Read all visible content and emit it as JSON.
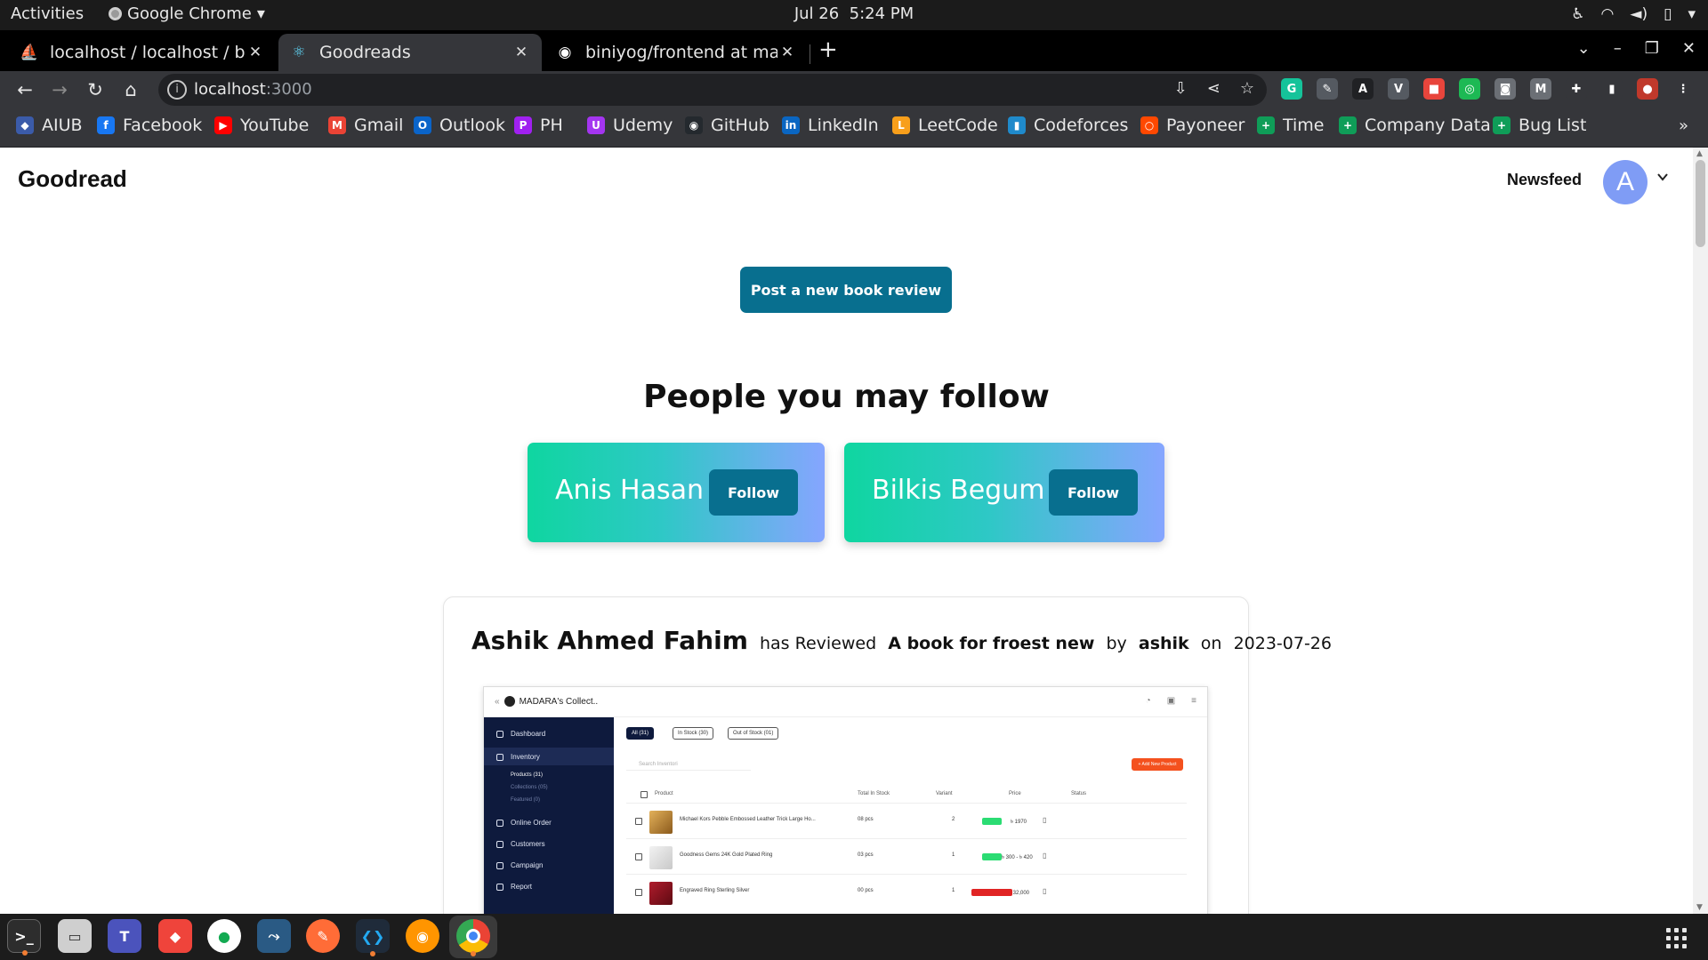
{
  "os": {
    "activities": "Activities",
    "app_name": "Google Chrome",
    "app_menu_arrow": "▾",
    "date": "Jul 26",
    "time": "5:24 PM",
    "tray_icons": [
      "accessibility-icon",
      "wifi-icon",
      "volume-icon",
      "battery-icon"
    ]
  },
  "tabs": [
    {
      "title": "localhost / localhost / bini",
      "favicon": "phpmyadmin-icon",
      "close": "✕"
    },
    {
      "title": "Goodreads",
      "favicon": "react-icon",
      "close": "✕",
      "active": true
    },
    {
      "title": "biniyog/frontend at main",
      "favicon": "github-icon",
      "close": "✕"
    }
  ],
  "new_tab": "+",
  "window_controls": {
    "tab_search": "⌄",
    "minimize": "–",
    "restore": "❐",
    "close": "✕"
  },
  "toolbar": {
    "back": "←",
    "forward": "→",
    "reload": "↻",
    "home": "⌂",
    "url_host": "localhost",
    "url_port": ":3000",
    "info": "i",
    "omni_icons": [
      "install-icon",
      "share-icon",
      "bookmark-star-icon"
    ]
  },
  "extensions": [
    {
      "name": "grammarly-icon",
      "glyph": "G",
      "color": "#15c39a"
    },
    {
      "name": "pen-extension-icon",
      "glyph": "✎",
      "color": "#555a61"
    },
    {
      "name": "font-extension-icon",
      "glyph": "A",
      "color": "#202124"
    },
    {
      "name": "vue-devtools-icon",
      "glyph": "V",
      "color": "#555a61"
    },
    {
      "name": "red-extension-icon",
      "glyph": "■",
      "color": "#e8453c"
    },
    {
      "name": "target-extension-icon",
      "glyph": "◎",
      "color": "#1db954"
    },
    {
      "name": "camera-extension-icon",
      "glyph": "◙",
      "color": "#6b6f75"
    },
    {
      "name": "m-extension-icon",
      "glyph": "M",
      "color": "#6b6f75"
    },
    {
      "name": "extensions-puzzle-icon",
      "glyph": "✚",
      "color": "#35363a"
    },
    {
      "name": "side-panel-icon",
      "glyph": "▮",
      "color": "#35363a"
    },
    {
      "name": "profile-avatar-icon",
      "glyph": "●",
      "color": "#c0392b"
    },
    {
      "name": "chrome-menu-icon",
      "glyph": "⋮",
      "color": "#35363a"
    }
  ],
  "bookmarks": [
    {
      "label": "AIUB",
      "icon": "aiub-icon",
      "color": "#3b5ba9",
      "glyph": "◆"
    },
    {
      "label": "Facebook",
      "icon": "facebook-icon",
      "color": "#1877f2",
      "glyph": "f"
    },
    {
      "label": "YouTube",
      "icon": "youtube-icon",
      "color": "#ff0000",
      "glyph": "▶"
    },
    {
      "label": "Gmail",
      "icon": "gmail-icon",
      "color": "#ea4335",
      "glyph": "M"
    },
    {
      "label": "Outlook",
      "icon": "outlook-icon",
      "color": "#0a64c9",
      "glyph": "O"
    },
    {
      "label": "PH",
      "icon": "ph-icon",
      "color": "#a020f0",
      "glyph": "P"
    },
    {
      "label": "Udemy",
      "icon": "udemy-icon",
      "color": "#a435f0",
      "glyph": "U"
    },
    {
      "label": "GitHub",
      "icon": "github-icon",
      "color": "#24292e",
      "glyph": "◉"
    },
    {
      "label": "LinkedIn",
      "icon": "linkedin-icon",
      "color": "#0a66c2",
      "glyph": "in"
    },
    {
      "label": "LeetCode",
      "icon": "leetcode-icon",
      "color": "#f89f1b",
      "glyph": "L"
    },
    {
      "label": "Codeforces",
      "icon": "codeforces-icon",
      "color": "#1f8acb",
      "glyph": "▮"
    },
    {
      "label": "Payoneer",
      "icon": "payoneer-icon",
      "color": "#ff4800",
      "glyph": "○"
    },
    {
      "label": "Time",
      "icon": "sheets-icon",
      "color": "#0f9d58",
      "glyph": "+"
    },
    {
      "label": "Company Data",
      "icon": "sheets-icon",
      "color": "#0f9d58",
      "glyph": "+"
    },
    {
      "label": "Bug List",
      "icon": "sheets-icon",
      "color": "#0f9d58",
      "glyph": "+"
    }
  ],
  "bookmarks_more": "»",
  "page": {
    "brand": "Goodread",
    "nav_newsfeed": "Newsfeed",
    "avatar_letter": "A",
    "post_button": "Post a new book review",
    "follow_section_title": "People you may follow",
    "suggestions": [
      {
        "name": "Anis Hasan",
        "button": "Follow"
      },
      {
        "name": "Bilkis Begum",
        "button": "Follow"
      }
    ],
    "review": {
      "reviewer": "Ashik Ahmed Fahim",
      "action": "has Reviewed",
      "book": "A book for froest new",
      "by_word": "by",
      "author": "ashik",
      "on_word": "on",
      "date": "2023-07-26"
    },
    "review_image": {
      "store_name": "MADARA's Collect..",
      "sidebar": {
        "dashboard": "Dashboard",
        "inventory": "Inventory",
        "products": "Products (31)",
        "collections": "Collections (05)",
        "featured": "Featured (0)",
        "online_order": "Online Order",
        "customers": "Customers",
        "campaign": "Campaign",
        "report": "Report"
      },
      "filters": {
        "all": "All (31)",
        "in_stock": "In Stock (30)",
        "out_of_stock": "Out of Stock (01)"
      },
      "search_placeholder": "Search Inventori",
      "add_button": "+ Add New Product",
      "headers": {
        "product": "Product",
        "stock": "Total In Stock",
        "variant": "Variant",
        "price": "Price",
        "status": "Status"
      },
      "rows": [
        {
          "product": "Michael Kors Pebble Embossed Leather Trick Large Ho...",
          "stock": "08 pcs",
          "variant": "2",
          "price": "৳ 1970",
          "status_color": "#2bdc73"
        },
        {
          "product": "Goodness Gems 24K Gold Plated Ring",
          "stock": "03 pcs",
          "variant": "1",
          "price": "৳ 300 - ৳ 420",
          "status_color": "#2bdc73"
        },
        {
          "product": "Engraved Ring Sterling Silver",
          "stock": "00 pcs",
          "variant": "1",
          "price": "৳ 32,000",
          "status_color": "#e02424"
        }
      ]
    }
  },
  "taskbar": [
    "terminal-icon",
    "files-icon",
    "teams-icon",
    "anydesk-icon",
    "mongodb-compass-icon",
    "mysql-workbench-icon",
    "postman-icon",
    "vscode-icon",
    "firefox-icon",
    "chrome-icon"
  ]
}
